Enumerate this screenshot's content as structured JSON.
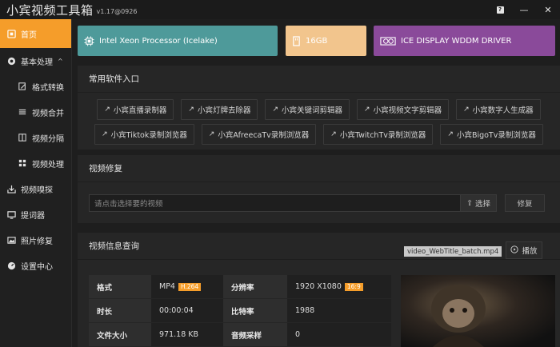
{
  "app": {
    "title": "小宾视频工具箱",
    "version": "v1.17@0926",
    "help_label": "?",
    "minimize_label": "—",
    "close_label": "✕"
  },
  "sidebar": {
    "items": [
      {
        "label": "首页",
        "icon": "home-icon",
        "active": true
      },
      {
        "label": "基本处理",
        "icon": "settings-icon",
        "expand": "^"
      },
      {
        "label": "格式转换",
        "icon": "edit-icon",
        "sub": true
      },
      {
        "label": "视频合并",
        "icon": "merge-icon",
        "sub": true
      },
      {
        "label": "视频分隔",
        "icon": "split-icon",
        "sub": true
      },
      {
        "label": "视频处理",
        "icon": "grid-icon",
        "sub": true
      },
      {
        "label": "视频嗅探",
        "icon": "download-icon"
      },
      {
        "label": "提词器",
        "icon": "monitor-icon"
      },
      {
        "label": "照片修复",
        "icon": "image-icon"
      },
      {
        "label": "设置中心",
        "icon": "gauge-icon"
      }
    ]
  },
  "hardware": {
    "cpu": "Intel Xeon Processor (Icelake)",
    "ram": "16GB",
    "gpu": "ICE DISPLAY WDDM DRIVER",
    "colors": {
      "cpu": "#4e9a9a",
      "ram": "#f2c58d",
      "gpu": "#8a4a9a"
    }
  },
  "common": {
    "title": "常用软件入口",
    "row1": [
      "小宾直播录制器",
      "小宾灯牌去除器",
      "小宾关键词剪辑器",
      "小宾视频文字剪辑器",
      "小宾数字人生成器"
    ],
    "row2": [
      "小宾Tiktok录制浏览器",
      "小宾AfreecaTv录制浏览器",
      "小宾TwitchTv录制浏览器",
      "小宾BigoTv录制浏览器"
    ]
  },
  "repair": {
    "title": "视频修复",
    "placeholder": "请点击选择要的视频",
    "choose_label": "选择",
    "repair_label": "修复"
  },
  "info": {
    "title": "视频信息查询",
    "filename": "video_WebTitle_batch.mp4",
    "play_label": "播放",
    "rows": [
      {
        "k1": "格式",
        "v1": "MP4",
        "tag1": "H.264",
        "k2": "分辨率",
        "v2": "1920 X1080",
        "tag2": "16:9"
      },
      {
        "k1": "时长",
        "v1": "00:00:04",
        "k2": "比特率",
        "v2": "1988"
      },
      {
        "k1": "文件大小",
        "v1": "971.18 KB",
        "k2": "音频采样",
        "v2": "0"
      }
    ]
  },
  "accent_color": "#f59d2a"
}
